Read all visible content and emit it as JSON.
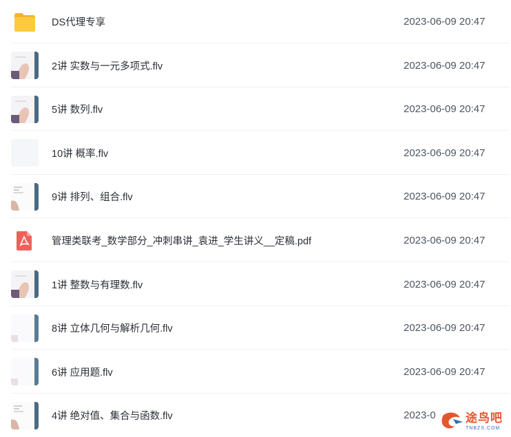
{
  "files": [
    {
      "name": "DS代理专享",
      "date": "2023-06-09 20:47",
      "icon": "folder-icon",
      "thumb": "folder"
    },
    {
      "name": "2讲 实数与一元多项式.flv",
      "date": "2023-06-09 20:47",
      "icon": "video-thumbnail-icon",
      "thumb": "hand"
    },
    {
      "name": "5讲 数列.flv",
      "date": "2023-06-09 20:47",
      "icon": "video-thumbnail-icon",
      "thumb": "hand"
    },
    {
      "name": "10讲 概率.flv",
      "date": "2023-06-09 20:47",
      "icon": "video-thumbnail-icon",
      "thumb": "blank"
    },
    {
      "name": "9讲 排列、组合.flv",
      "date": "2023-06-09 20:47",
      "icon": "video-thumbnail-icon",
      "thumb": "board"
    },
    {
      "name": "管理类联考_数学部分_冲刺串讲_袁进_学生讲义__定稿.pdf",
      "date": "2023-06-09 20:47",
      "icon": "pdf-icon",
      "thumb": "pdf"
    },
    {
      "name": "1讲 整数与有理数.flv",
      "date": "2023-06-09 20:47",
      "icon": "video-thumbnail-icon",
      "thumb": "hand"
    },
    {
      "name": "8讲 立体几何与解析几何.flv",
      "date": "2023-06-09 20:47",
      "icon": "video-thumbnail-icon",
      "thumb": "white"
    },
    {
      "name": "6讲 应用题.flv",
      "date": "2023-06-09 20:47",
      "icon": "video-thumbnail-icon",
      "thumb": "white"
    },
    {
      "name": "4讲 绝对值、集合与函数.flv",
      "date": "2023-0",
      "icon": "video-thumbnail-icon",
      "thumb": "board"
    }
  ],
  "watermark": {
    "cn": "途鸟吧",
    "en": "TNBZS.COM"
  },
  "colors": {
    "folder": "#f9c43c",
    "pdf": "#f0605a",
    "divider": "#eef0f3",
    "accent": "#e4572e"
  }
}
